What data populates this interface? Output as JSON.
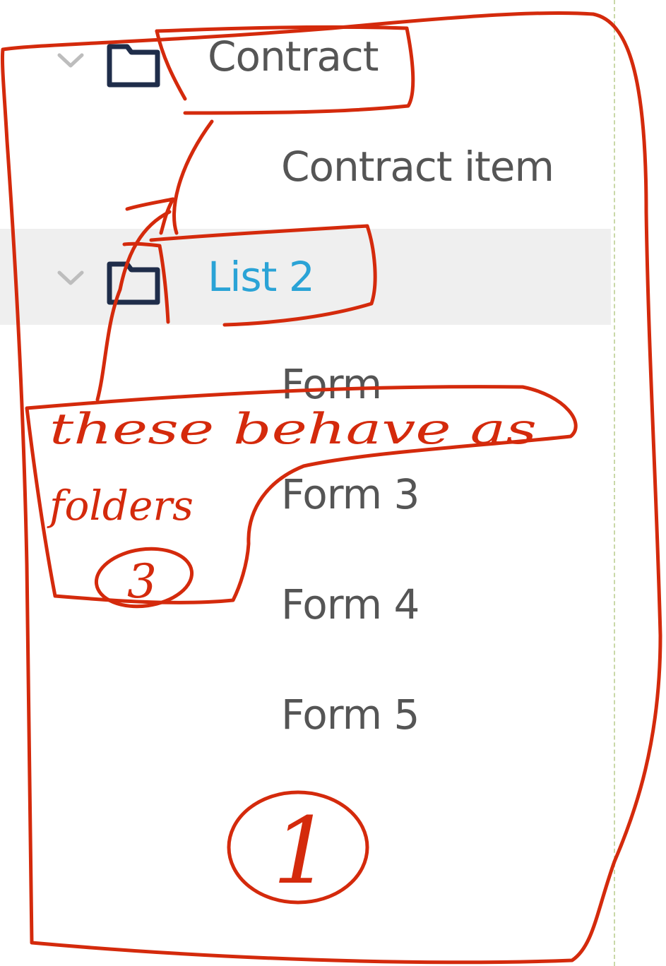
{
  "tree": {
    "items": [
      {
        "label": "Contract",
        "kind": "folder",
        "expanded": true,
        "selected": false
      },
      {
        "label": "Contract item",
        "kind": "item"
      },
      {
        "label": "List 2",
        "kind": "folder",
        "expanded": true,
        "selected": true
      },
      {
        "label": "Form",
        "kind": "item"
      },
      {
        "label": "Form 3",
        "kind": "item"
      },
      {
        "label": "Form 4",
        "kind": "item"
      },
      {
        "label": "Form 5",
        "kind": "item"
      }
    ]
  },
  "colors": {
    "annotation": "#d42a0c",
    "selected_text": "#2aa3d6",
    "selected_row": "#efefef",
    "folder_icon": "#1f2d4a",
    "text": "#555555"
  },
  "icons": {
    "chevron": "chevron-down-icon",
    "folder": "folder-icon"
  },
  "annotations": {
    "note_line1": "these behave as",
    "note_line2": "folders",
    "marker_3": "3",
    "marker_1": "1"
  }
}
